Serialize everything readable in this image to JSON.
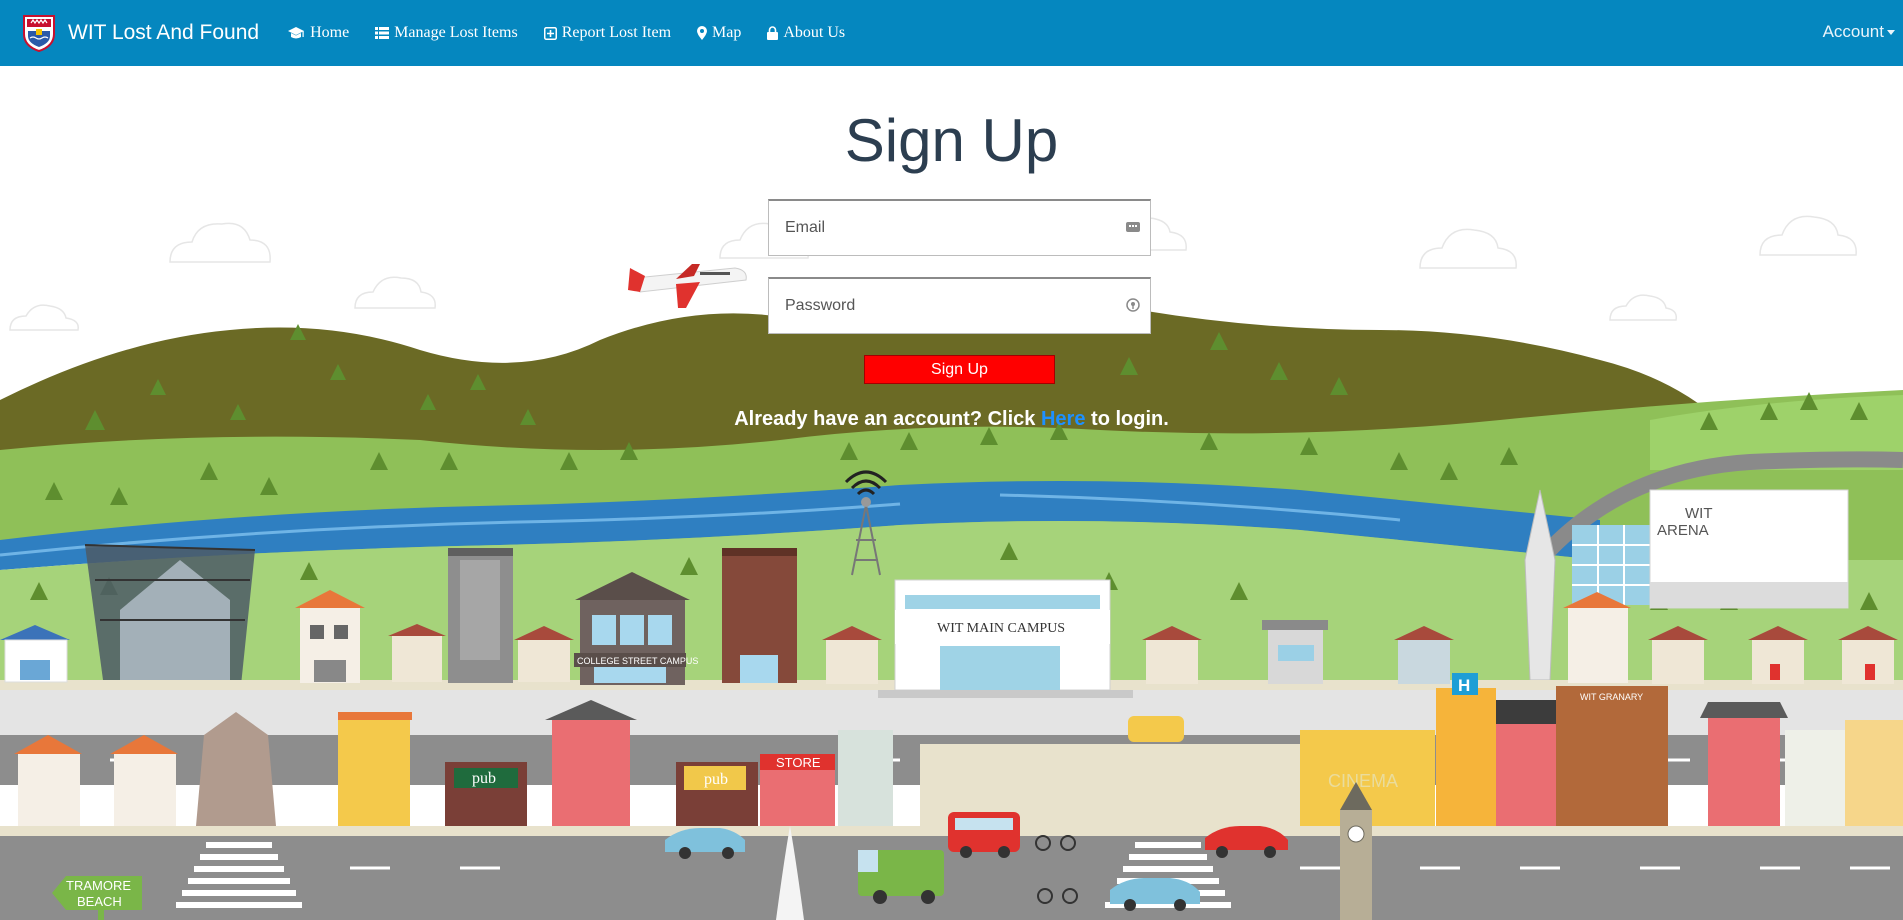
{
  "nav": {
    "brand": "WIT Lost And Found",
    "links": [
      {
        "label": "Home",
        "icon": "graduation-cap-icon"
      },
      {
        "label": "Manage Lost Items",
        "icon": "list-icon"
      },
      {
        "label": "Report Lost Item",
        "icon": "plus-square-icon"
      },
      {
        "label": "Map",
        "icon": "map-marker-icon"
      },
      {
        "label": "About Us",
        "icon": "lock-icon"
      }
    ],
    "account": "Account"
  },
  "form": {
    "title": "Sign Up",
    "email_placeholder": "Email",
    "password_placeholder": "Password",
    "submit_label": "Sign Up",
    "login_prefix": "Already have an account? Click",
    "login_link": "Here",
    "login_suffix": "to login."
  },
  "scene": {
    "college_street": "COLLEGE STREET CAMPUS",
    "main_campus": "WIT MAIN CAMPUS",
    "arena_line1": "WIT",
    "arena_line2": "ARENA",
    "granary": "WIT GRANARY",
    "pub1": "pub",
    "pub2": "pub",
    "store": "STORE",
    "cinema": "CINEMA",
    "hospital": "H",
    "beach_line1": "TRAMORE",
    "beach_line2": "BEACH"
  },
  "colors": {
    "navbar": "#0587bf",
    "title": "#2c3e50",
    "button": "#ff0000",
    "link": "#1e90ff"
  }
}
